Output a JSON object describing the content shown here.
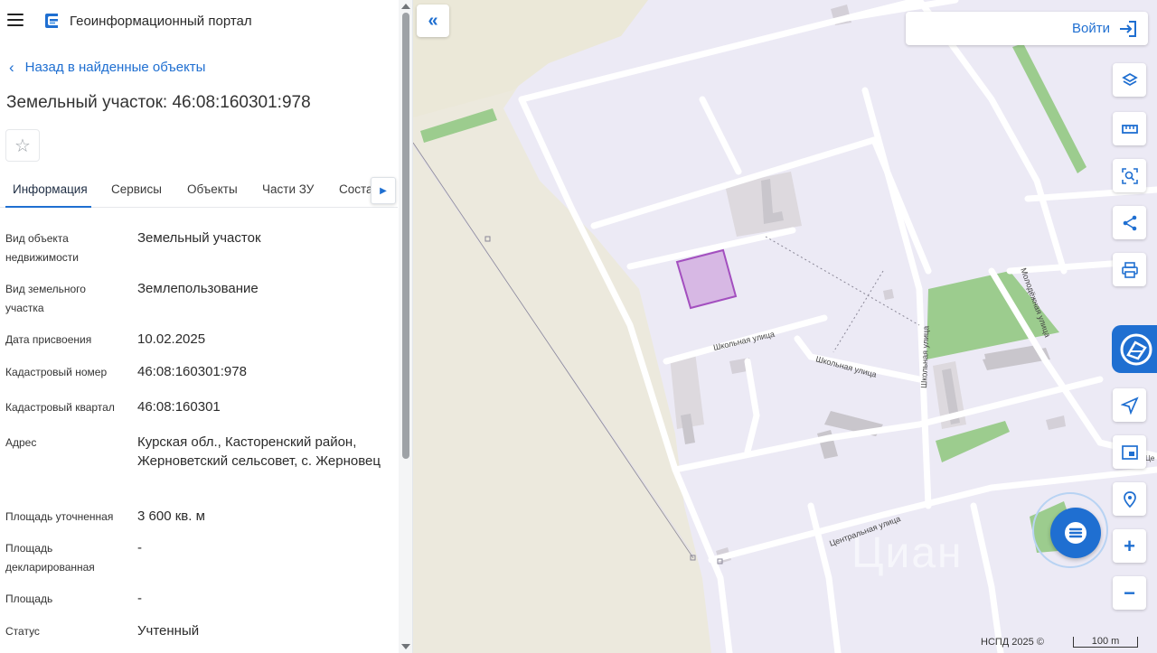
{
  "header": {
    "portal_title": "Геоинформационный портал"
  },
  "navigation": {
    "back_label": "Назад в найденные объекты"
  },
  "object": {
    "title": "Земельный участок: 46:08:160301:978"
  },
  "tabs": [
    {
      "label": "Информация",
      "active": true
    },
    {
      "label": "Сервисы",
      "active": false
    },
    {
      "label": "Объекты",
      "active": false
    },
    {
      "label": "Части ЗУ",
      "active": false
    },
    {
      "label": "Соста",
      "active": false
    }
  ],
  "properties": [
    {
      "label": "Вид объекта недвижимости",
      "value": "Земельный участок"
    },
    {
      "label": "Вид земельного участка",
      "value": "Землепользование"
    },
    {
      "label": "Дата присвоения",
      "value": "10.02.2025"
    },
    {
      "label": "Кадастровый номер",
      "value": "46:08:160301:978"
    },
    {
      "label": "Кадастровый квартал",
      "value": "46:08:160301"
    },
    {
      "label": "Адрес",
      "value": "Курская обл., Касторенский район, Жерноветский сельсовет, с. Жерновец"
    },
    {
      "label": "Площадь уточненная",
      "value": "3 600 кв. м"
    },
    {
      "label": "Площадь декларированная",
      "value": "-"
    },
    {
      "label": "Площадь",
      "value": "-"
    },
    {
      "label": "Статус",
      "value": "Учтенный"
    }
  ],
  "map": {
    "login_label": "Войти",
    "street_labels": {
      "shkolnaya_1": "Школьная улица",
      "shkolnaya_2": "Школьная улица",
      "shkolnaya_3": "Школьная улица",
      "molodezhnaya": "Молодёжная улица",
      "centralnaya": "Центральная улица",
      "edge": "Це"
    },
    "watermark": "Циан",
    "attribution": "НСПД 2025 ©",
    "scale_label": "100 m",
    "colors": {
      "accent": "#1f6fd1",
      "map_background": "#eceaf5",
      "green_area": "#9ccc8e",
      "selected_parcel": "#c78ad8"
    }
  }
}
